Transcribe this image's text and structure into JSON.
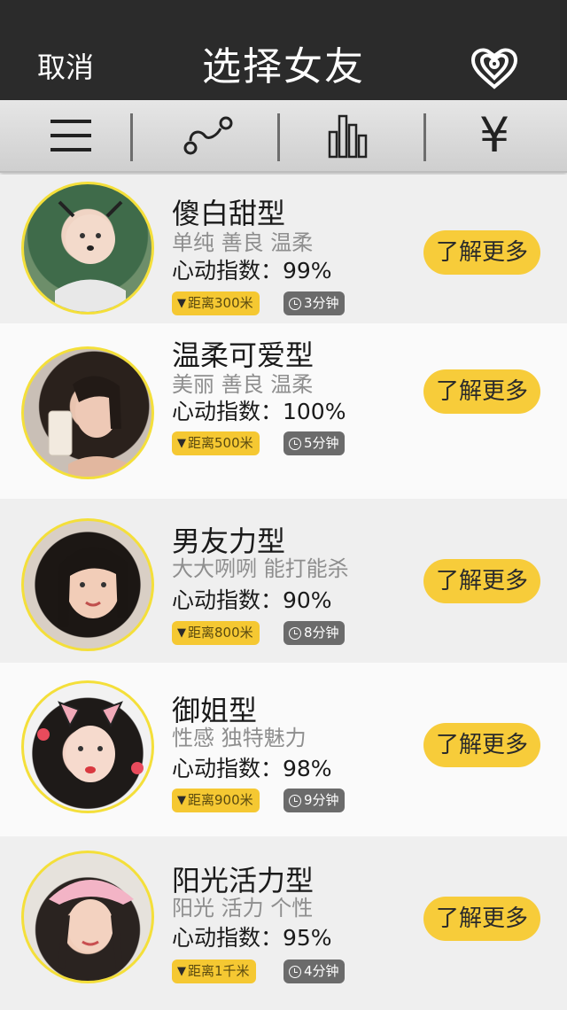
{
  "header": {
    "cancel_label": "取消",
    "title": "选择女友",
    "location_icon": "location-pin-icon"
  },
  "filter_bar": {
    "items": [
      {
        "icon": "menu-icon"
      },
      {
        "icon": "distance-icon"
      },
      {
        "icon": "bar-chart-icon"
      },
      {
        "icon": "yen-icon",
        "glyph": "¥"
      }
    ]
  },
  "profiles": [
    {
      "name": "傻白甜型",
      "tags": "单纯 善良 温柔",
      "score": "心动指数：99%",
      "distance": "距离300米",
      "time": "3分钟",
      "more": "了解更多"
    },
    {
      "name": "温柔可爱型",
      "tags": "美丽 善良 温柔",
      "score": "心动指数：100%",
      "distance": "距离500米",
      "time": "5分钟",
      "more": "了解更多"
    },
    {
      "name": "男友力型",
      "tags": "大大咧咧 能打能杀",
      "score": "心动指数：90%",
      "distance": "距离800米",
      "time": "8分钟",
      "more": "了解更多"
    },
    {
      "name": "御姐型",
      "tags": "性感 独特魅力",
      "score": "心动指数：98%",
      "distance": "距离900米",
      "time": "9分钟",
      "more": "了解更多"
    },
    {
      "name": "阳光活力型",
      "tags": "阳光 活力 个性",
      "score": "心动指数：95%",
      "distance": "距离1千米",
      "time": "4分钟",
      "more": "了解更多"
    }
  ],
  "colors": {
    "header_bg": "#2b2b2b",
    "accent_yellow": "#f7cc3a",
    "avatar_ring": "#f4df3a",
    "tag_gray": "#8e8e8e"
  }
}
